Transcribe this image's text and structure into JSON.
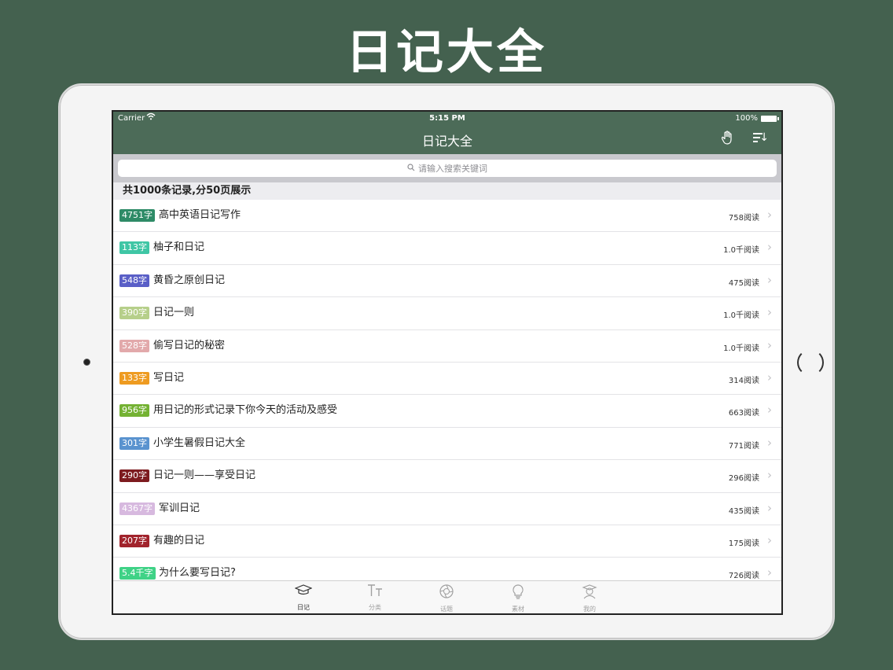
{
  "promo": {
    "title": "日记大全"
  },
  "status_bar": {
    "carrier": "Carrier",
    "time": "5:15 PM",
    "battery": "100%"
  },
  "nav": {
    "title": "日记大全"
  },
  "search": {
    "placeholder": "请输入搜索关键词"
  },
  "list_header": "共1000条记录,分50页展示",
  "rows": [
    {
      "badge": "4751字",
      "badge_color": "#2e8b67",
      "title": "高中英语日记写作",
      "reads": "758阅读"
    },
    {
      "badge": "113字",
      "badge_color": "#3fc6a5",
      "title": "柚子和日记",
      "reads": "1.0千阅读"
    },
    {
      "badge": "548字",
      "badge_color": "#5a5fc7",
      "title": "黄昏之原创日记",
      "reads": "475阅读"
    },
    {
      "badge": "390字",
      "badge_color": "#b6cf8a",
      "title": "日记一则",
      "reads": "1.0千阅读"
    },
    {
      "badge": "528字",
      "badge_color": "#e2a9ab",
      "title": "偷写日记的秘密",
      "reads": "1.0千阅读"
    },
    {
      "badge": "133字",
      "badge_color": "#ee9b21",
      "title": "写日记",
      "reads": "314阅读"
    },
    {
      "badge": "956字",
      "badge_color": "#74b233",
      "title": "用日记的形式记录下你今天的活动及感受",
      "reads": "663阅读"
    },
    {
      "badge": "301字",
      "badge_color": "#5a93cf",
      "title": "小学生暑假日记大全",
      "reads": "771阅读"
    },
    {
      "badge": "290字",
      "badge_color": "#7d1b1f",
      "title": "日记一则——享受日记",
      "reads": "296阅读"
    },
    {
      "badge": "4367字",
      "badge_color": "#d7b9df",
      "title": "军训日记",
      "reads": "435阅读"
    },
    {
      "badge": "207字",
      "badge_color": "#a1232c",
      "title": "有趣的日记",
      "reads": "175阅读"
    },
    {
      "badge": "5.4千字",
      "badge_color": "#3fd286",
      "title": "为什么要写日记?",
      "reads": "726阅读"
    }
  ],
  "tabs": [
    {
      "label": "日记",
      "icon": "graduation-cap-icon",
      "active": true
    },
    {
      "label": "分类",
      "icon": "text-size-icon",
      "active": false
    },
    {
      "label": "话题",
      "icon": "aperture-icon",
      "active": false
    },
    {
      "label": "素材",
      "icon": "lightbulb-icon",
      "active": false
    },
    {
      "label": "我的",
      "icon": "user-graduate-icon",
      "active": false
    }
  ]
}
